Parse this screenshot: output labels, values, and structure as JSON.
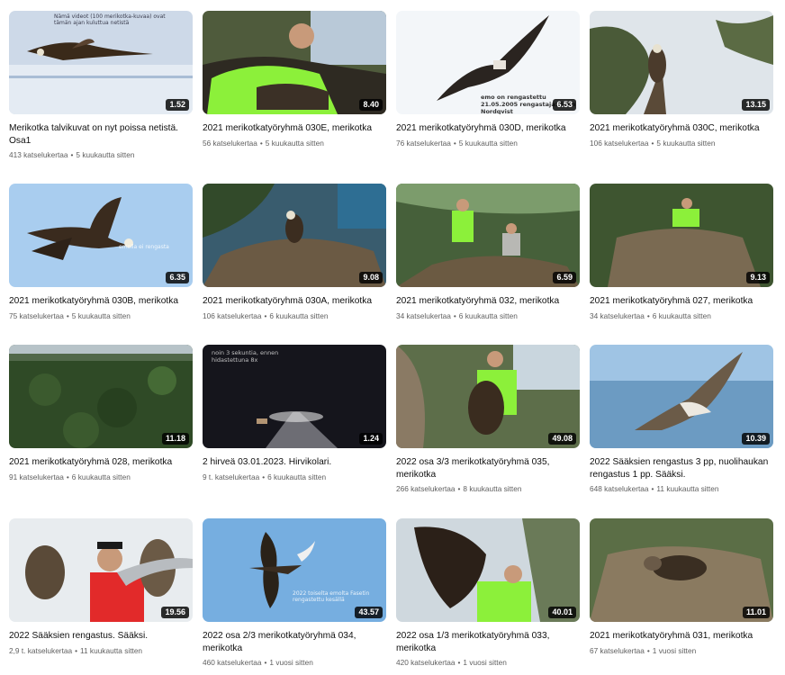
{
  "videos": [
    {
      "title": "Merikotka talvikuvat on nyt poissa netistä. Osa1",
      "duration": "1.52",
      "views": "413 katselukertaa",
      "age": "5 kuukautta sitten",
      "overlay": "Nämä videot (100 merikotka-kuvaa) ovat tämän ajan kuluttua netistä"
    },
    {
      "title": "2021 merikotkatyöryhmä 030E, merikotka",
      "duration": "8.40",
      "views": "56 katselukertaa",
      "age": "5 kuukautta sitten",
      "overlay": ""
    },
    {
      "title": "2021 merikotkatyöryhmä 030D, merikotka",
      "duration": "6.53",
      "views": "76 katselukertaa",
      "age": "5 kuukautta sitten",
      "overlay": "emo on rengastettu 21.05.2005 rengastaja: Sven Nordqvist"
    },
    {
      "title": "2021 merikotkatyöryhmä 030C, merikotka",
      "duration": "13.15",
      "views": "106 katselukertaa",
      "age": "5 kuukautta sitten",
      "overlay": ""
    },
    {
      "title": "2021 merikotkatyöryhmä 030B, merikotka",
      "duration": "6.35",
      "views": "75 katselukertaa",
      "age": "5 kuukautta sitten",
      "overlay": "emolla ei rengasta"
    },
    {
      "title": "2021 merikotkatyöryhmä 030A, merikotka",
      "duration": "9.08",
      "views": "106 katselukertaa",
      "age": "6 kuukautta sitten",
      "overlay": ""
    },
    {
      "title": "2021 merikotkatyöryhmä 032, merikotka",
      "duration": "6.59",
      "views": "34 katselukertaa",
      "age": "6 kuukautta sitten",
      "overlay": ""
    },
    {
      "title": "2021 merikotkatyöryhmä 027, merikotka",
      "duration": "9.13",
      "views": "34 katselukertaa",
      "age": "6 kuukautta sitten",
      "overlay": ""
    },
    {
      "title": "2021 merikotkatyöryhmä 028, merikotka",
      "duration": "11.18",
      "views": "91 katselukertaa",
      "age": "6 kuukautta sitten",
      "overlay": ""
    },
    {
      "title": "2 hirveä 03.01.2023. Hirvikolari.",
      "duration": "1.24",
      "views": "9 t. katselukertaa",
      "age": "6 kuukautta sitten",
      "overlay": "noin 3 sekuntia, ennen hidastettuna 8x"
    },
    {
      "title": "2022 osa 3/3 merikotkatyöryhmä 035, merikotka",
      "duration": "49.08",
      "views": "266 katselukertaa",
      "age": "8 kuukautta sitten",
      "overlay": ""
    },
    {
      "title": "2022 Sääksien rengastus 3 pp, nuolihaukan rengastus 1 pp. Sääksi.",
      "duration": "10.39",
      "views": "648 katselukertaa",
      "age": "11 kuukautta sitten",
      "overlay": ""
    },
    {
      "title": "2022 Sääksien rengastus. Sääksi.",
      "duration": "19.56",
      "views": "2,9 t. katselukertaa",
      "age": "11 kuukautta sitten",
      "overlay": ""
    },
    {
      "title": "2022 osa 2/3 merikotkatyöryhmä 034, merikotka",
      "duration": "43.57",
      "views": "460 katselukertaa",
      "age": "1 vuosi sitten",
      "overlay": "2022 toiselta emolta Fasetin rengastettu kesällä"
    },
    {
      "title": "2022 osa 1/3 merikotkatyöryhmä 033, merikotka",
      "duration": "40.01",
      "views": "420 katselukertaa",
      "age": "1 vuosi sitten",
      "overlay": ""
    },
    {
      "title": "2021 merikotkatyöryhmä 031, merikotka",
      "duration": "11.01",
      "views": "67 katselukertaa",
      "age": "1 vuosi sitten",
      "overlay": ""
    }
  ],
  "colors": {
    "title_text": "#0f0f0f",
    "meta_text": "#606060",
    "duration_bg": "#000000"
  }
}
